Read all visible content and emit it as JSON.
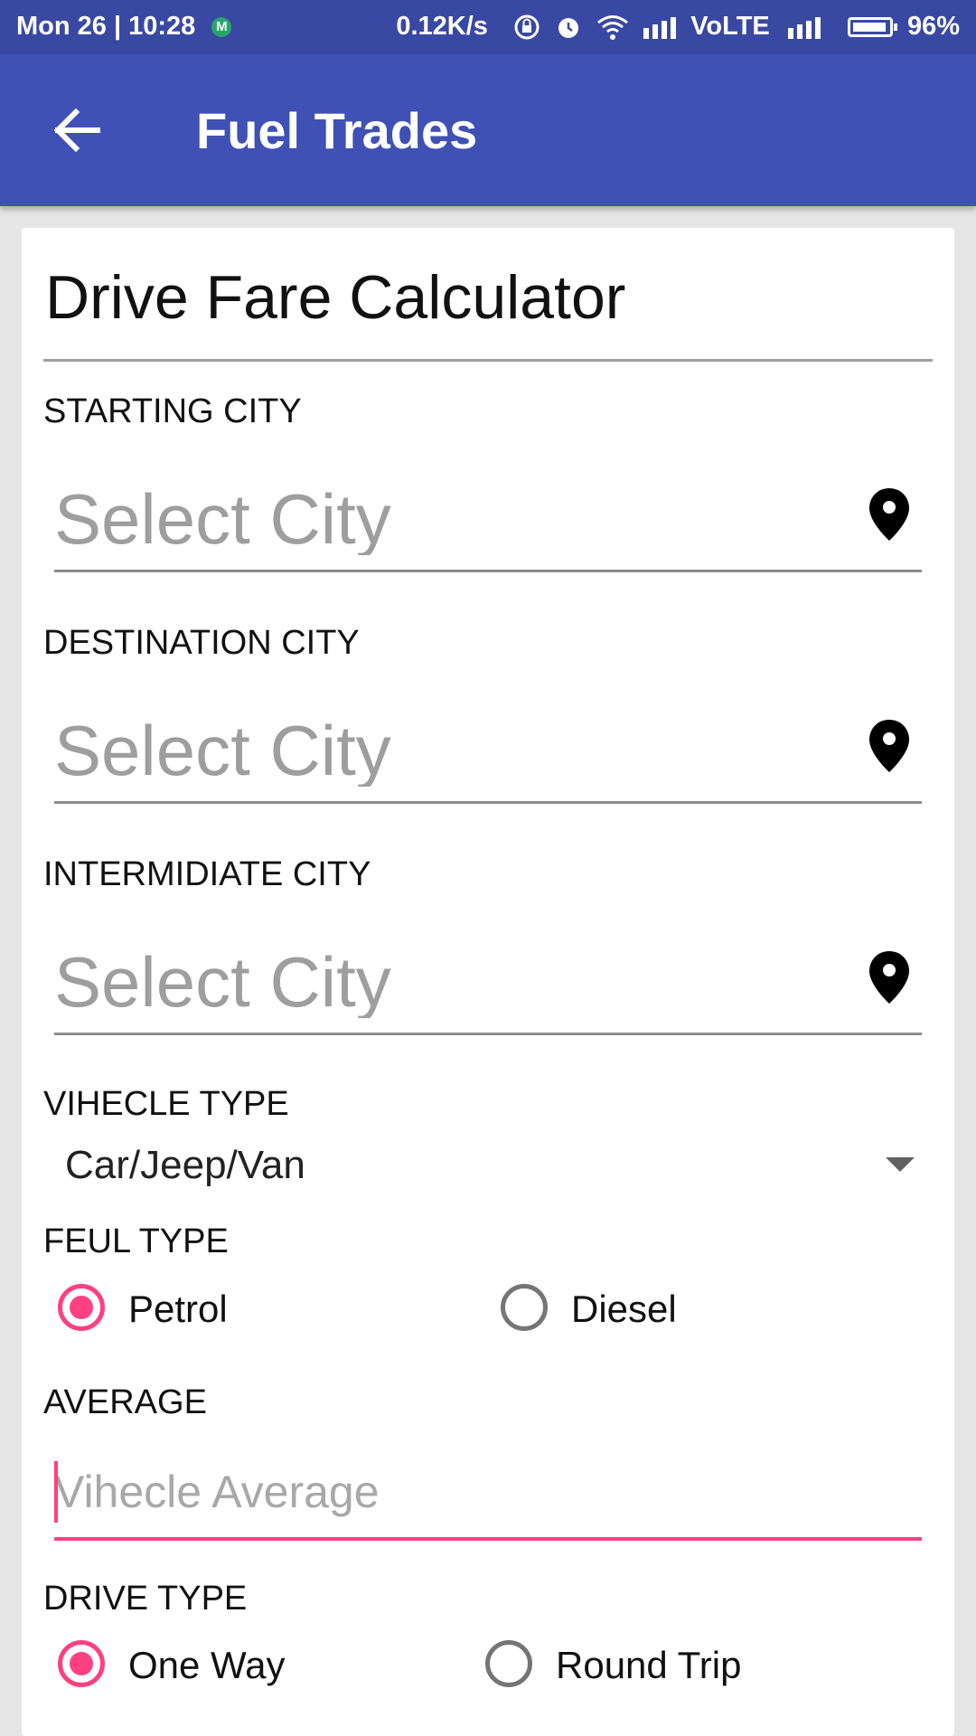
{
  "status_bar": {
    "time": "Mon 26 | 10:28",
    "notification_icon": "M",
    "net_speed": "0.12K/s",
    "network": "VoLTE",
    "battery": "96%"
  },
  "app_bar": {
    "title": "Fuel Trades",
    "back_icon": "arrow-back-icon"
  },
  "form": {
    "title": "Drive Fare Calculator",
    "starting_city": {
      "label": "STARTING CITY",
      "placeholder": "Select City",
      "value": ""
    },
    "destination_city": {
      "label": "DESTINATION CITY",
      "placeholder": "Select City",
      "value": ""
    },
    "intermediate_city": {
      "label": "INTERMIDIATE CITY",
      "placeholder": "Select City",
      "value": ""
    },
    "vehicle_type": {
      "label": "VIHECLE TYPE",
      "selected": "Car/Jeep/Van"
    },
    "fuel_type": {
      "label": "FEUL TYPE",
      "options": [
        {
          "label": "Petrol",
          "checked": true
        },
        {
          "label": "Diesel",
          "checked": false
        }
      ]
    },
    "average": {
      "label": "AVERAGE",
      "placeholder": "Vihecle Average",
      "value": ""
    },
    "drive_type": {
      "label": "DRIVE TYPE",
      "options": [
        {
          "label": "One Way",
          "checked": true
        },
        {
          "label": "Round Trip",
          "checked": false
        }
      ]
    }
  },
  "colors": {
    "primary": "#3f51b5",
    "primary_dark": "#3949a3",
    "accent": "#ff4081"
  }
}
